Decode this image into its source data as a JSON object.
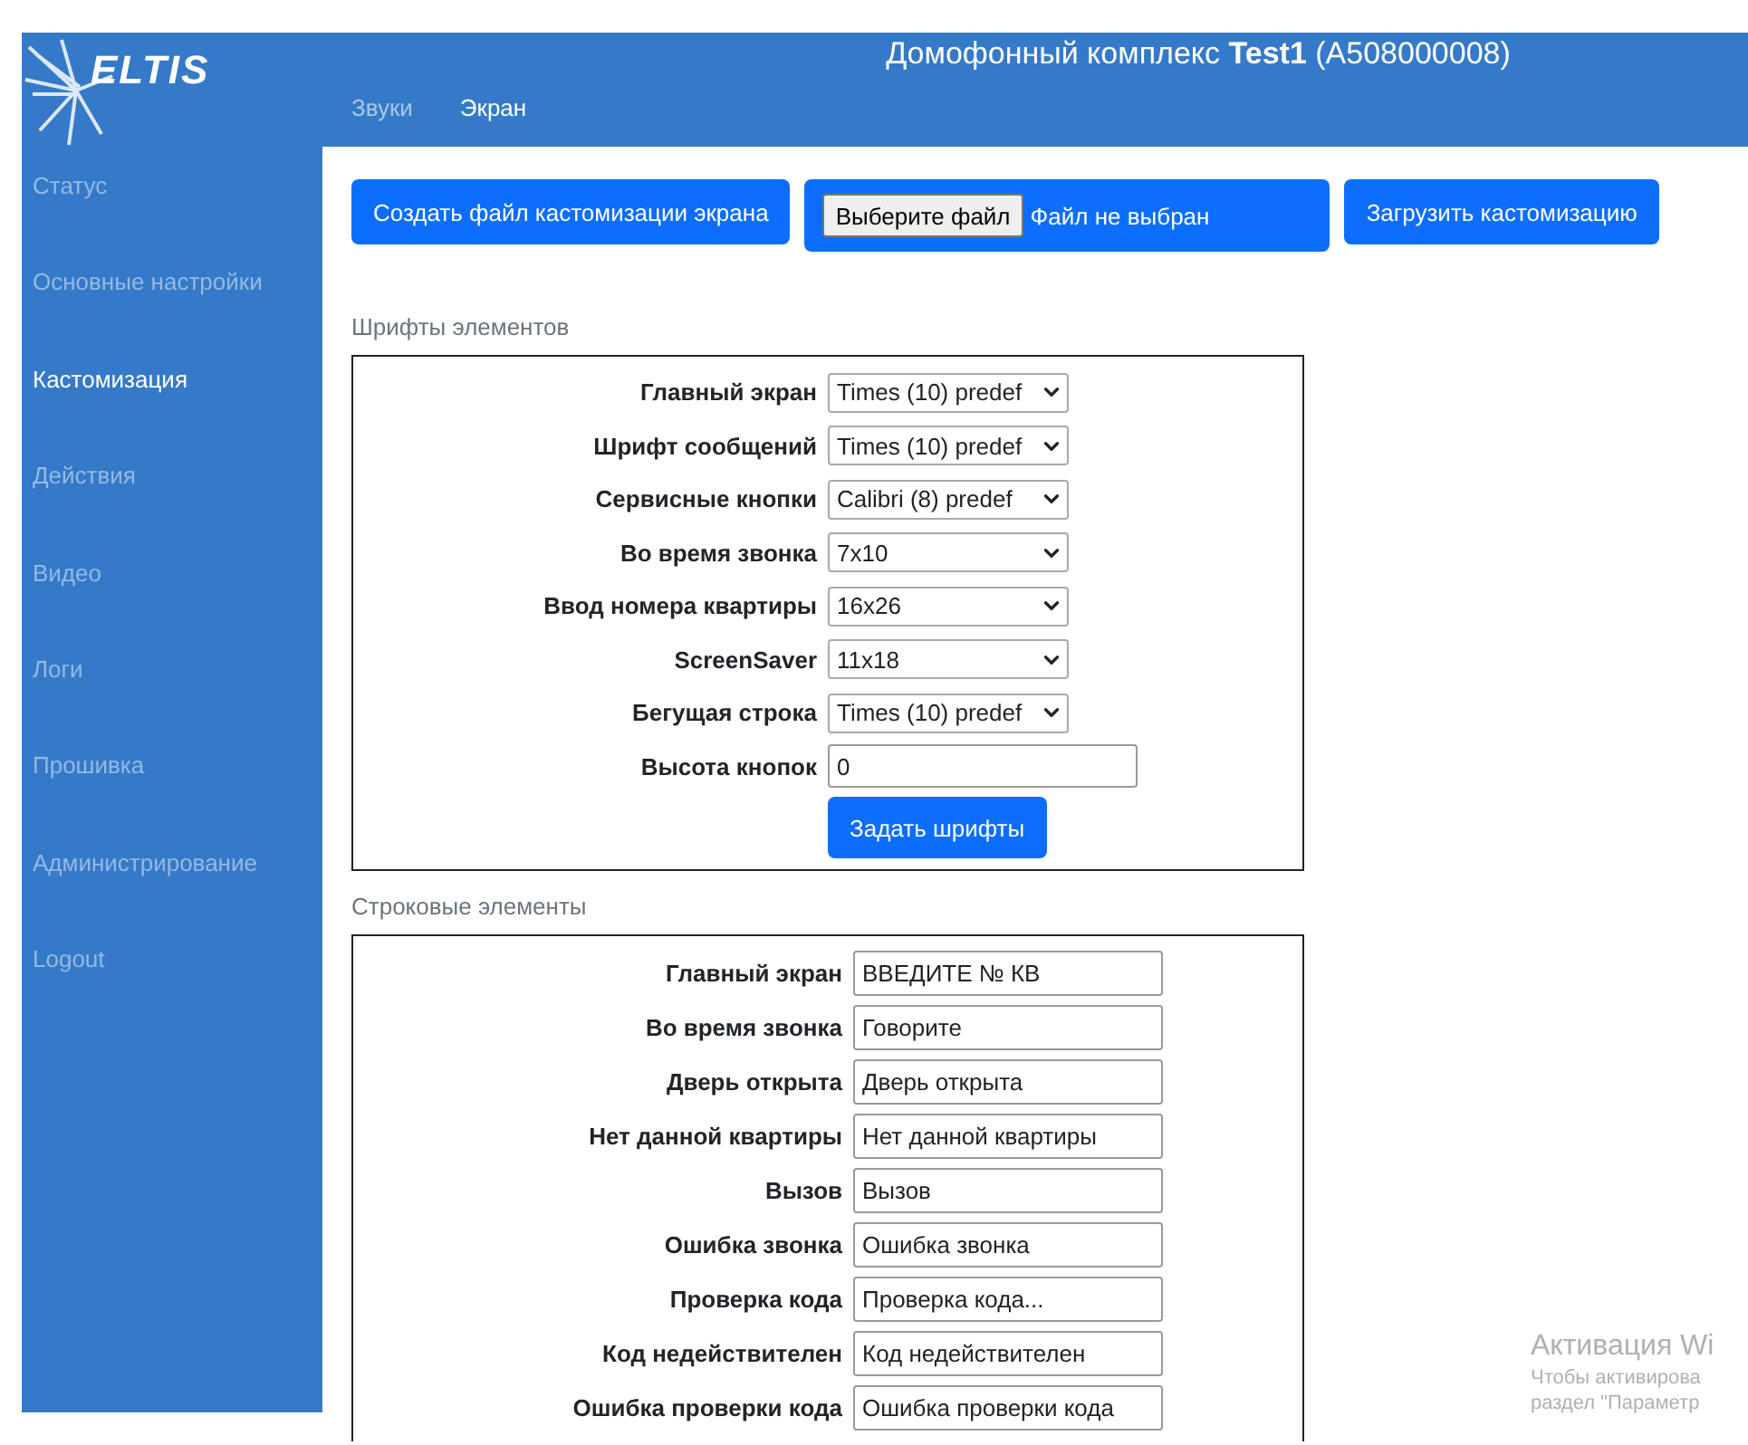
{
  "header": {
    "logo_text": "ELTIS",
    "title": "Домофонный комплекс **Test1** (A508000008)",
    "tabs": [
      {
        "label": "Звуки",
        "selected": false
      },
      {
        "label": "Экран",
        "selected": true
      }
    ]
  },
  "sidebar": {
    "items": [
      {
        "label": "Статус",
        "selected": false
      },
      {
        "label": "Основные настройки",
        "selected": false
      },
      {
        "label": "Кастомизация",
        "selected": true
      },
      {
        "label": "Действия",
        "selected": false
      },
      {
        "label": "Видео",
        "selected": false
      },
      {
        "label": "Логи",
        "selected": false
      },
      {
        "label": "Прошивка",
        "selected": false
      },
      {
        "label": "Администрирование",
        "selected": false
      },
      {
        "label": "Logout",
        "selected": false
      }
    ]
  },
  "toolbar": {
    "create_button": "Создать файл кастомизации экрана",
    "file_picker": {
      "button": "Выберите файл",
      "status": "Файл не выбран"
    },
    "upload_button": "Загрузить кастомизацию"
  },
  "fonts_section": {
    "title": "Шрифты элементов",
    "rows": [
      {
        "kind": "select",
        "label": "Главный экран",
        "value": "Times (10) predef"
      },
      {
        "kind": "select",
        "label": "Шрифт сообщений",
        "value": "Times (10) predef"
      },
      {
        "kind": "select",
        "label": "Сервисные кнопки",
        "value": "Calibri (8) predef"
      },
      {
        "kind": "select",
        "label": "Во время звонка",
        "value": "7x10"
      },
      {
        "kind": "select",
        "label": "Ввод номера квартиры",
        "value": "16x26"
      },
      {
        "kind": "select",
        "label": "ScreenSaver",
        "value": "11x18"
      },
      {
        "kind": "select",
        "label": "Бегущая строка",
        "value": "Times (10) predef"
      },
      {
        "kind": "input",
        "label": "Высота кнопок",
        "value": "0"
      }
    ],
    "submit": "Задать шрифты"
  },
  "strings_section": {
    "title": "Строковые элементы",
    "rows": [
      {
        "label": "Главный экран",
        "value": "ВВЕДИТЕ № КВ"
      },
      {
        "label": "Во время звонка",
        "value": "Говорите"
      },
      {
        "label": "Дверь открыта",
        "value": "Дверь открыта"
      },
      {
        "label": "Нет данной квартиры",
        "value": "Нет данной квартиры"
      },
      {
        "label": "Вызов",
        "value": "Вызов"
      },
      {
        "label": "Ошибка звонка",
        "value": "Ошибка звонка"
      },
      {
        "label": "Проверка кода",
        "value": "Проверка кода..."
      },
      {
        "label": "Код недействителен",
        "value": "Код недействителен"
      },
      {
        "label": "Ошибка проверки кода",
        "value": "Ошибка проверки кода"
      }
    ]
  },
  "activation_notice": {
    "title": "Активация Wi",
    "lines": [
      "Чтобы активирова",
      "раздел \"Параметр"
    ]
  }
}
